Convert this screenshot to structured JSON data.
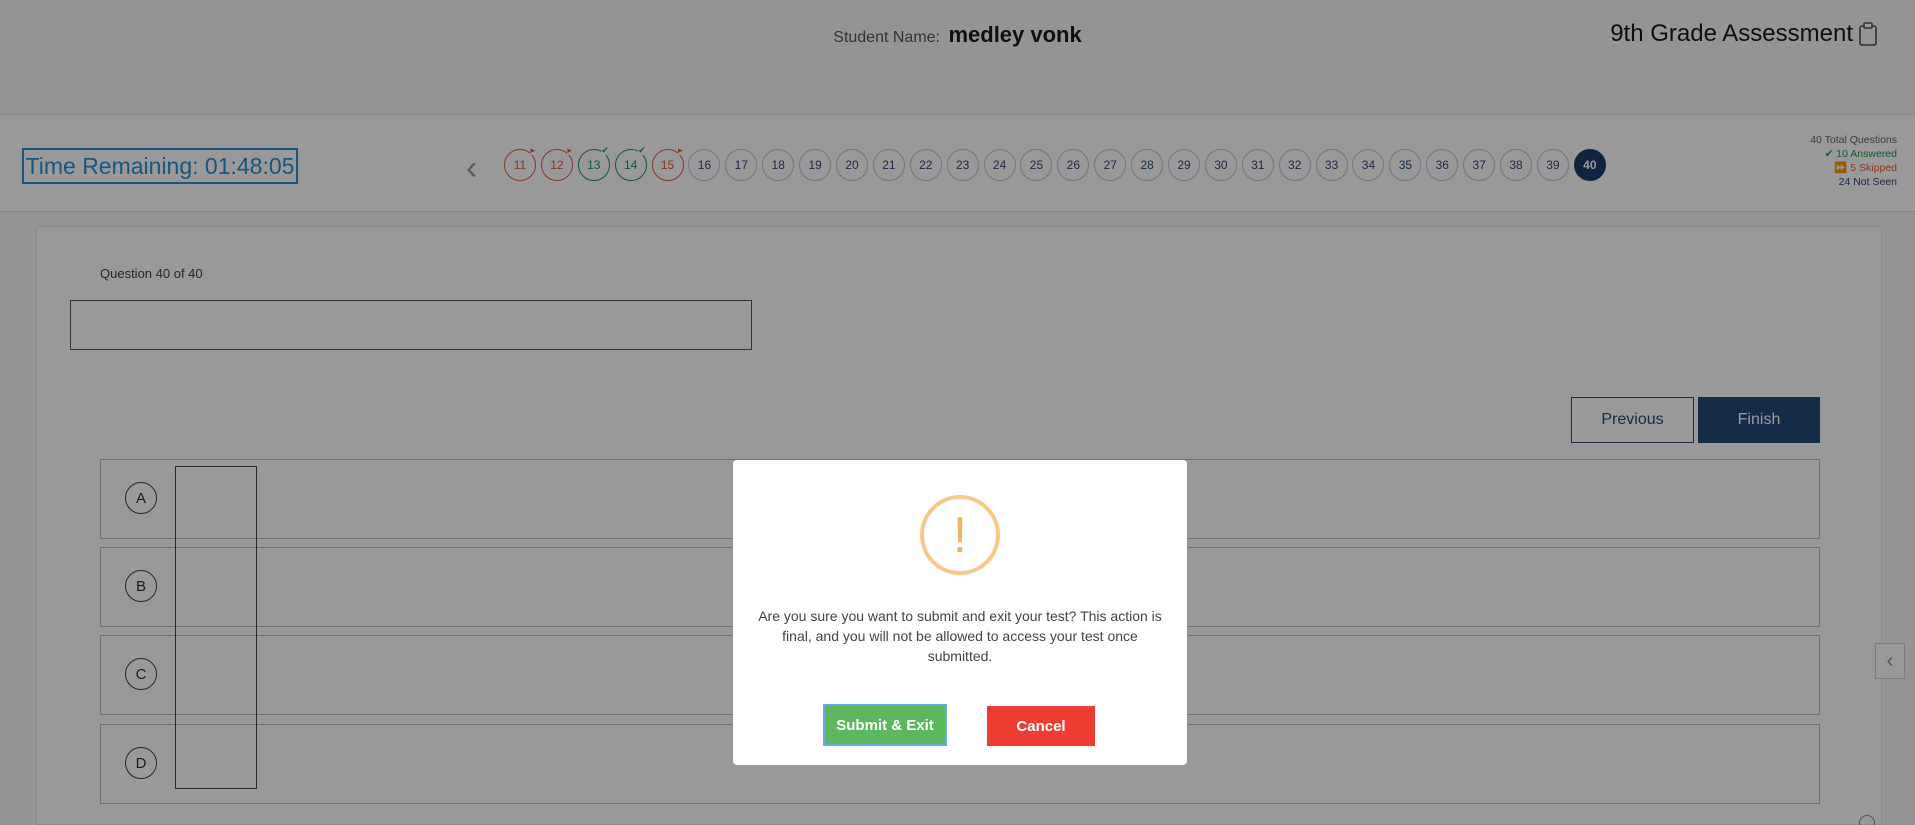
{
  "header": {
    "student_label": "Student Name:",
    "student_name": "medley vonk",
    "assessment_title": "9th Grade Assessment",
    "assessment_icon": "clipboard-icon"
  },
  "nav": {
    "timer_label": "Time Remaining: 01:48:05",
    "question_numbers": [
      {
        "n": "11",
        "state": "skipped"
      },
      {
        "n": "12",
        "state": "skipped"
      },
      {
        "n": "13",
        "state": "answered"
      },
      {
        "n": "14",
        "state": "answered"
      },
      {
        "n": "15",
        "state": "skipped"
      },
      {
        "n": "16",
        "state": "not-seen"
      },
      {
        "n": "17",
        "state": "not-seen"
      },
      {
        "n": "18",
        "state": "not-seen"
      },
      {
        "n": "19",
        "state": "not-seen"
      },
      {
        "n": "20",
        "state": "not-seen"
      },
      {
        "n": "21",
        "state": "not-seen"
      },
      {
        "n": "22",
        "state": "not-seen"
      },
      {
        "n": "23",
        "state": "not-seen"
      },
      {
        "n": "24",
        "state": "not-seen"
      },
      {
        "n": "25",
        "state": "not-seen"
      },
      {
        "n": "26",
        "state": "not-seen"
      },
      {
        "n": "27",
        "state": "not-seen"
      },
      {
        "n": "28",
        "state": "not-seen"
      },
      {
        "n": "29",
        "state": "not-seen"
      },
      {
        "n": "30",
        "state": "not-seen"
      },
      {
        "n": "31",
        "state": "not-seen"
      },
      {
        "n": "32",
        "state": "not-seen"
      },
      {
        "n": "33",
        "state": "not-seen"
      },
      {
        "n": "34",
        "state": "not-seen"
      },
      {
        "n": "35",
        "state": "not-seen"
      },
      {
        "n": "36",
        "state": "not-seen"
      },
      {
        "n": "37",
        "state": "not-seen"
      },
      {
        "n": "38",
        "state": "not-seen"
      },
      {
        "n": "39",
        "state": "not-seen"
      },
      {
        "n": "40",
        "state": "current"
      }
    ],
    "legend": {
      "total": "40 Total Questions",
      "answered": "10 Answered",
      "skipped": "5 Skipped",
      "not_seen": "24 Not Seen"
    }
  },
  "question": {
    "label": "Question 40 of 40",
    "previous_label": "Previous",
    "finish_label": "Finish",
    "options": [
      "A",
      "B",
      "C",
      "D"
    ]
  },
  "modal": {
    "icon": "exclamation-icon",
    "icon_glyph": "!",
    "message": "Are you sure you want to submit and exit your test? This action is final, and you will not be allowed to access your test once submitted.",
    "submit_label": "Submit & Exit",
    "cancel_label": "Cancel"
  },
  "colors": {
    "timer": "#2a8fd6",
    "answered": "#1f9a4a",
    "skipped": "#e65c3c",
    "current": "#1c3c6c",
    "finish": "#234a7a",
    "submit": "#5cb85c",
    "cancel": "#ef3d33",
    "warning": "#f4b05b"
  }
}
